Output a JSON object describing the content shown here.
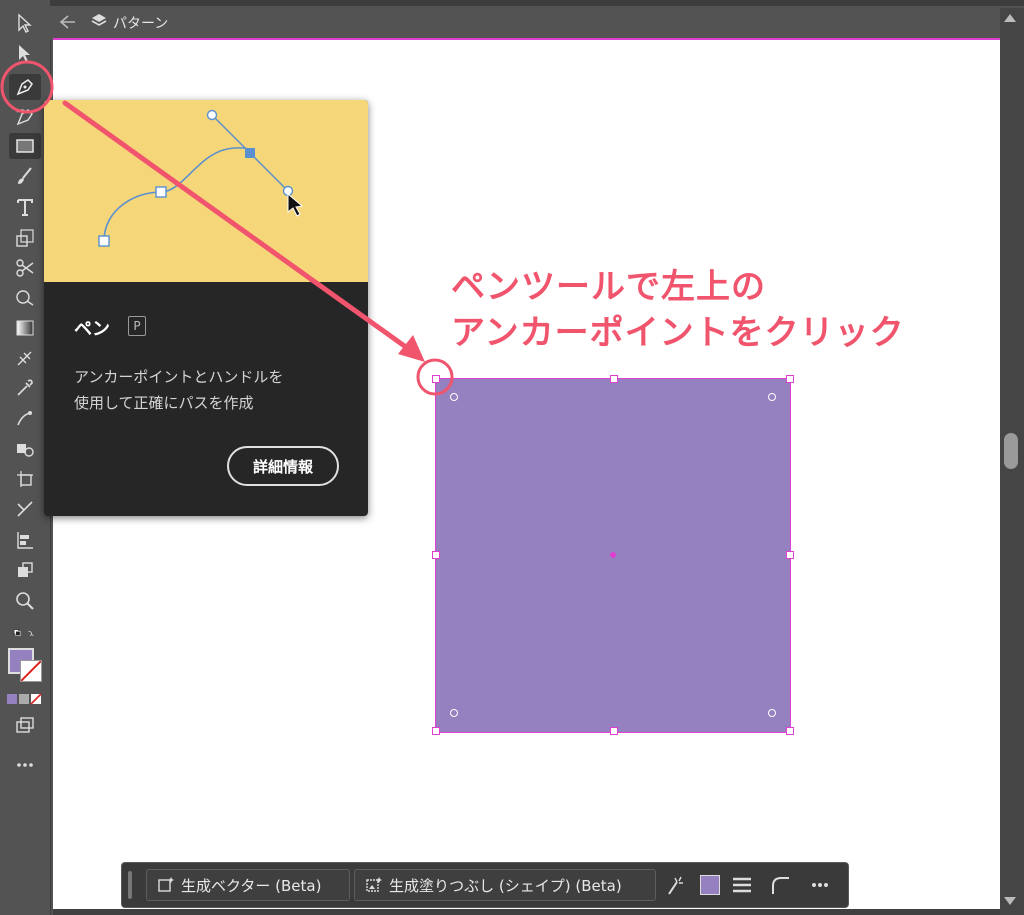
{
  "header": {
    "breadcrumb": "パターン"
  },
  "tooltip": {
    "title": "ペン",
    "shortcut": "P",
    "description_line1": "アンカーポイントとハンドルを",
    "description_line2": "使用して正確にパスを作成",
    "more_button": "詳細情報"
  },
  "annotation": {
    "line1": "ペンツールで左上の",
    "line2": "アンカーポイントをクリック"
  },
  "taskbar": {
    "gen_vector_label": "生成ベクター (Beta)",
    "gen_fill_label": "生成塗りつぶし (シェイプ) (Beta)"
  },
  "colors": {
    "fill": "#9681c0",
    "selection": "#e040d0",
    "annotation": "#f0556d",
    "tooltip_preview_bg": "#f5d77a"
  },
  "icons": {
    "toolbar": [
      "selection-arrow-icon",
      "direct-selection-icon",
      "pen-tool-icon",
      "curvature-tool-icon",
      "rectangle-tool-icon",
      "paintbrush-icon",
      "type-tool-icon",
      "scale-tool-icon",
      "scissors-icon",
      "shape-builder-icon",
      "gradient-icon",
      "mesh-icon",
      "eyedropper-icon",
      "puppet-warp-icon",
      "live-paint-icon",
      "artboard-icon",
      "slice-icon",
      "graph-icon",
      "symbol-sprayer-icon",
      "zoom-icon",
      "swap-colors-icon",
      "fill-swatch",
      "stroke-swatch",
      "color-mode-icons",
      "screen-mode-icon",
      "more-tools-icon"
    ]
  }
}
